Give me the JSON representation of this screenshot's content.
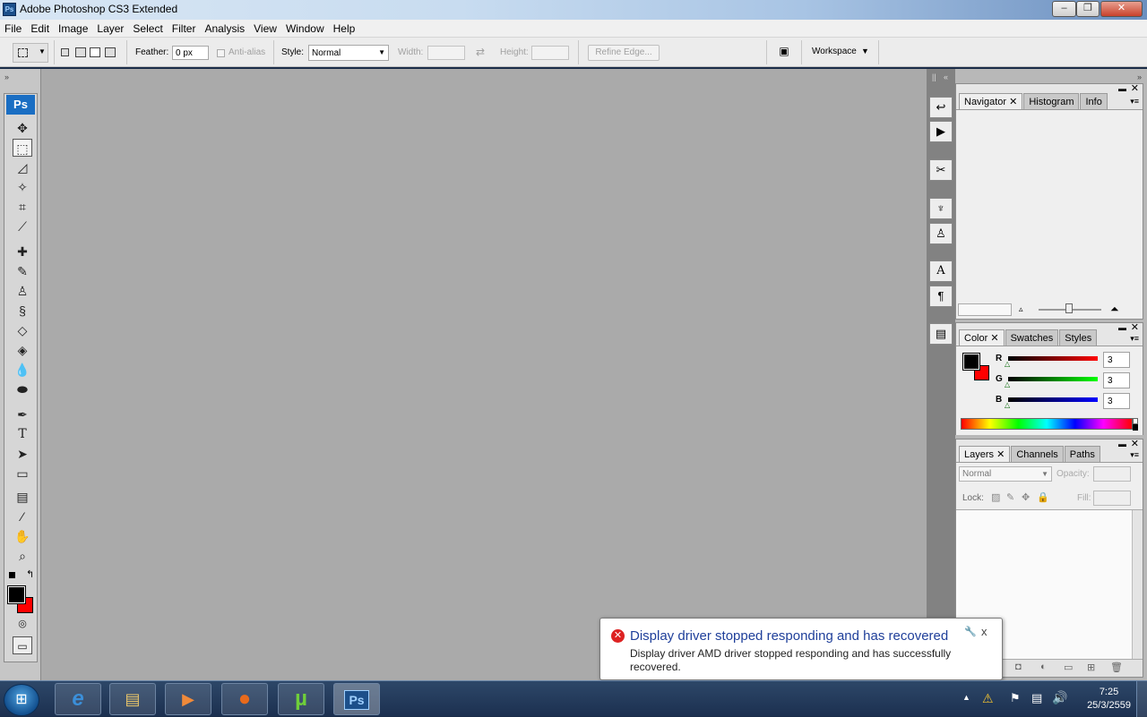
{
  "window": {
    "title": "Adobe Photoshop CS3 Extended",
    "logo": "Ps",
    "minimize": "–",
    "maximize": "❐",
    "close": "✕"
  },
  "menu": [
    "File",
    "Edit",
    "Image",
    "Layer",
    "Select",
    "Filter",
    "Analysis",
    "View",
    "Window",
    "Help"
  ],
  "options": {
    "feather_label": "Feather:",
    "feather_value": "0 px",
    "antialias_label": "Anti-alias",
    "style_label": "Style:",
    "style_value": "Normal",
    "width_label": "Width:",
    "height_label": "Height:",
    "refine_edge": "Refine Edge...",
    "workspace": "Workspace"
  },
  "toolbox": {
    "logo": "Ps"
  },
  "panels": {
    "navigator": {
      "tabs": [
        "Navigator",
        "Histogram",
        "Info"
      ]
    },
    "color": {
      "tabs": [
        "Color",
        "Swatches",
        "Styles"
      ],
      "channels": [
        {
          "label": "R",
          "value": "3"
        },
        {
          "label": "G",
          "value": "3"
        },
        {
          "label": "B",
          "value": "3"
        }
      ],
      "foreground": "#000000",
      "background": "#ff0000"
    },
    "layers": {
      "tabs": [
        "Layers",
        "Channels",
        "Paths"
      ],
      "blend_mode": "Normal",
      "opacity_label": "Opacity:",
      "lock_label": "Lock:",
      "fill_label": "Fill:"
    }
  },
  "notification": {
    "title": "Display driver stopped responding and has recovered",
    "body": "Display driver AMD driver stopped responding and has successfully recovered.",
    "close": "x"
  },
  "taskbar": {
    "items": [
      {
        "name": "internet-explorer",
        "glyph": "e",
        "color": "#3b8fd9"
      },
      {
        "name": "file-explorer",
        "glyph": "▤",
        "color": "#e8c56a"
      },
      {
        "name": "media-player",
        "glyph": "▶",
        "color": "#f08a3a"
      },
      {
        "name": "firefox",
        "glyph": "●",
        "color": "#e86a1c"
      },
      {
        "name": "utorrent",
        "glyph": "µ",
        "color": "#6fcf3a"
      },
      {
        "name": "photoshop",
        "glyph": "Ps",
        "color": "#9fd0ff"
      }
    ],
    "time": "7:25",
    "date": "25/3/2559"
  }
}
